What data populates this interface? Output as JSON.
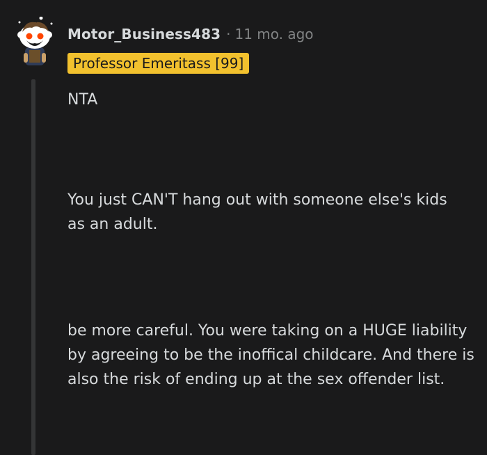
{
  "comment": {
    "username": "Motor_Business483",
    "separator": "·",
    "timestamp": "11 mo. ago",
    "flair": "Professor Emeritass [99]",
    "paragraphs": [
      "NTA",
      "You just CAN'T hang out with someone else's kids as an adult.",
      "be more careful. You were taking on a HUGE liability by agreeing to be the inoffical childcare. And there is also the risk of ending up at the sex offender list."
    ]
  },
  "colors": {
    "background": "#1a1a1b",
    "text": "#d7dadc",
    "muted": "#818384",
    "flair_bg": "#f2c12e",
    "thread_line": "#343536"
  }
}
